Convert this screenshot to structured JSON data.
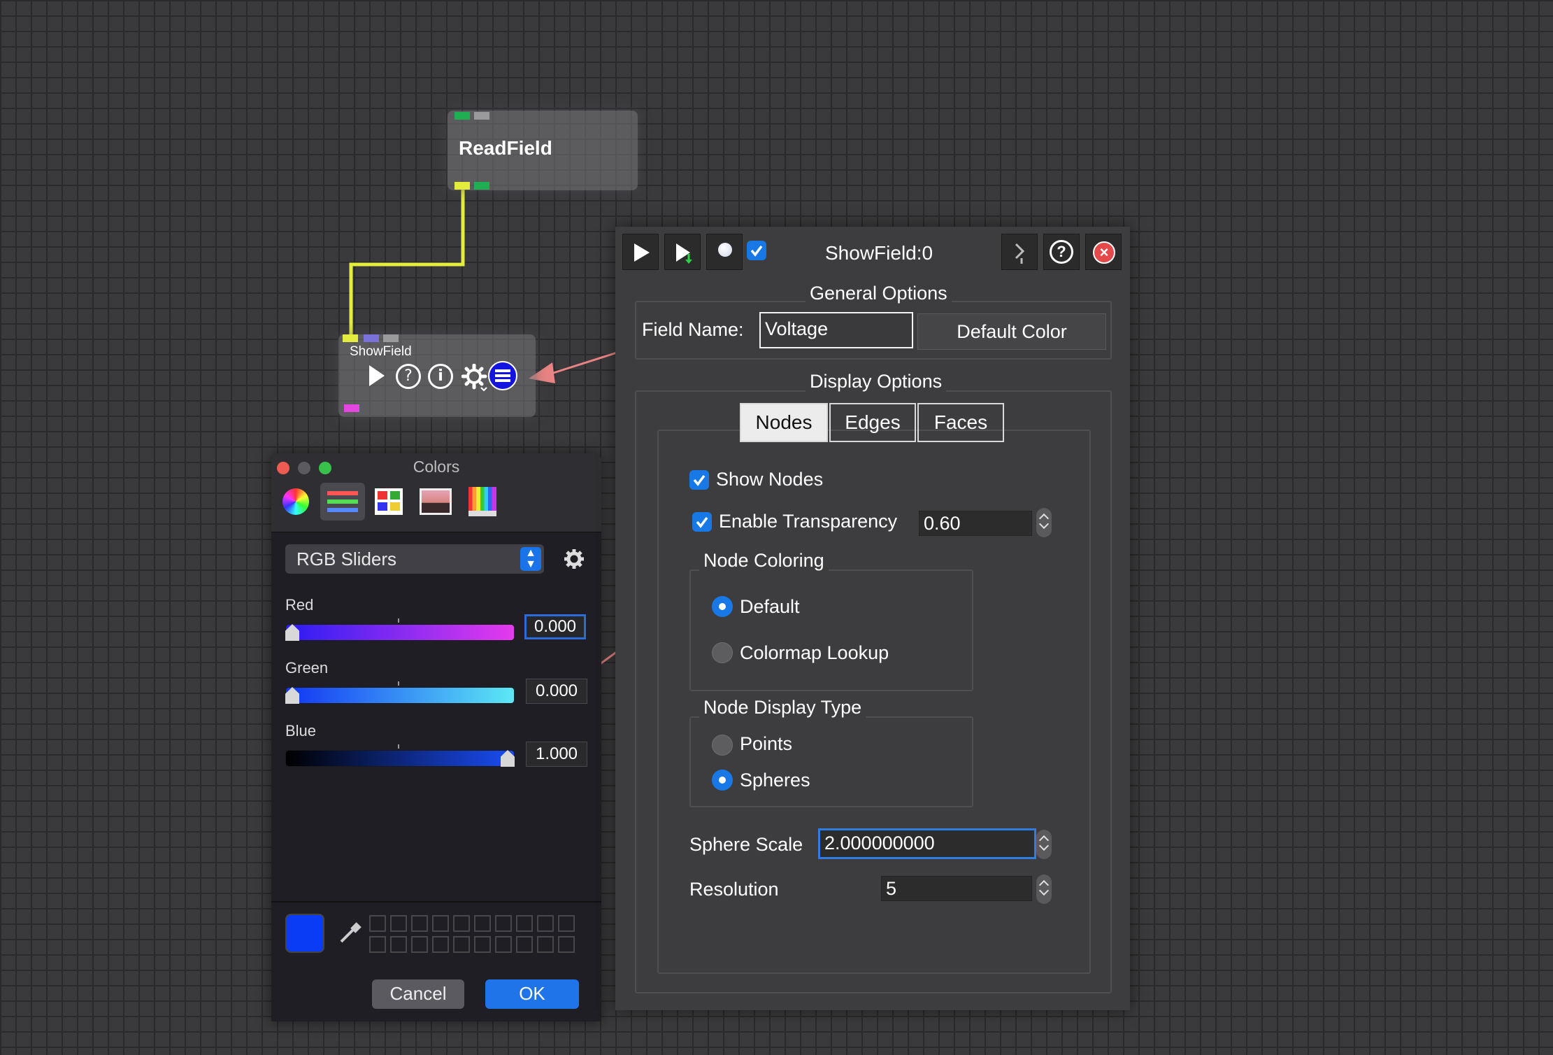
{
  "canvas": {
    "readfield": {
      "title": "ReadField"
    },
    "showfield": {
      "title": "ShowField"
    },
    "colors": {
      "wire": "#e4ec3e",
      "arrow": "#e98484",
      "port_green": "#1fae52",
      "port_purple": "#7a72d8",
      "port_magenta": "#e546e0",
      "port_yellow": "#e4ec3e"
    }
  },
  "showfield_dialog": {
    "title": "ShowField:0",
    "toolbar": {
      "execute_icon": "play-icon",
      "execute_down_icon": "play-downstream-icon",
      "record_icon": "record-icon",
      "enabled_icon": "checkbox-icon",
      "collapse_icon": "collapse-icon",
      "help_icon": "help-icon",
      "close_icon": "close-icon"
    },
    "general": {
      "title": "General Options",
      "field_name_label": "Field Name:",
      "field_name_value": "Voltage",
      "default_color_button": "Default Color"
    },
    "display": {
      "title": "Display Options",
      "tabs": [
        "Nodes",
        "Edges",
        "Faces"
      ],
      "active_tab": "Nodes",
      "show_nodes_label": "Show Nodes",
      "show_nodes_checked": true,
      "transparency_label": "Enable Transparency",
      "transparency_checked": true,
      "transparency_value": "0.60",
      "node_coloring": {
        "title": "Node Coloring",
        "options": [
          "Default",
          "Colormap Lookup"
        ],
        "selected": "Default"
      },
      "node_display_type": {
        "title": "Node Display Type",
        "options": [
          "Points",
          "Spheres"
        ],
        "selected": "Spheres"
      },
      "sphere_scale_label": "Sphere Scale",
      "sphere_scale_value": "2.000000000",
      "resolution_label": "Resolution",
      "resolution_value": "5"
    }
  },
  "colors_panel": {
    "title": "Colors",
    "mode_icons": [
      "color-wheel-icon",
      "sliders-icon",
      "palettes-icon",
      "image-icon",
      "pencils-icon"
    ],
    "mode_select": "RGB Sliders",
    "settings_icon": "gear-icon",
    "red": {
      "label": "Red",
      "value": "0.000",
      "level": 0.0
    },
    "green": {
      "label": "Green",
      "value": "0.000",
      "level": 0.0
    },
    "blue": {
      "label": "Blue",
      "value": "1.000",
      "level": 1.0
    },
    "current_color": "#0a3cf5",
    "eyedropper_icon": "eyedropper-icon",
    "cancel_label": "Cancel",
    "ok_label": "OK"
  }
}
